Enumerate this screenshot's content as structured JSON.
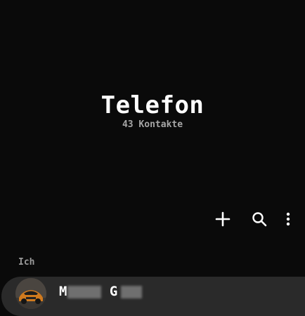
{
  "header": {
    "title": "Telefon",
    "subtitle": "43 Kontakte"
  },
  "toolbar": {
    "add_icon": "plus-icon",
    "search_icon": "search-icon",
    "more_icon": "more-vertical-icon"
  },
  "section": {
    "label": "Ich"
  },
  "me": {
    "name_start": "M",
    "name_mid": "G",
    "avatar": "car-photo"
  }
}
